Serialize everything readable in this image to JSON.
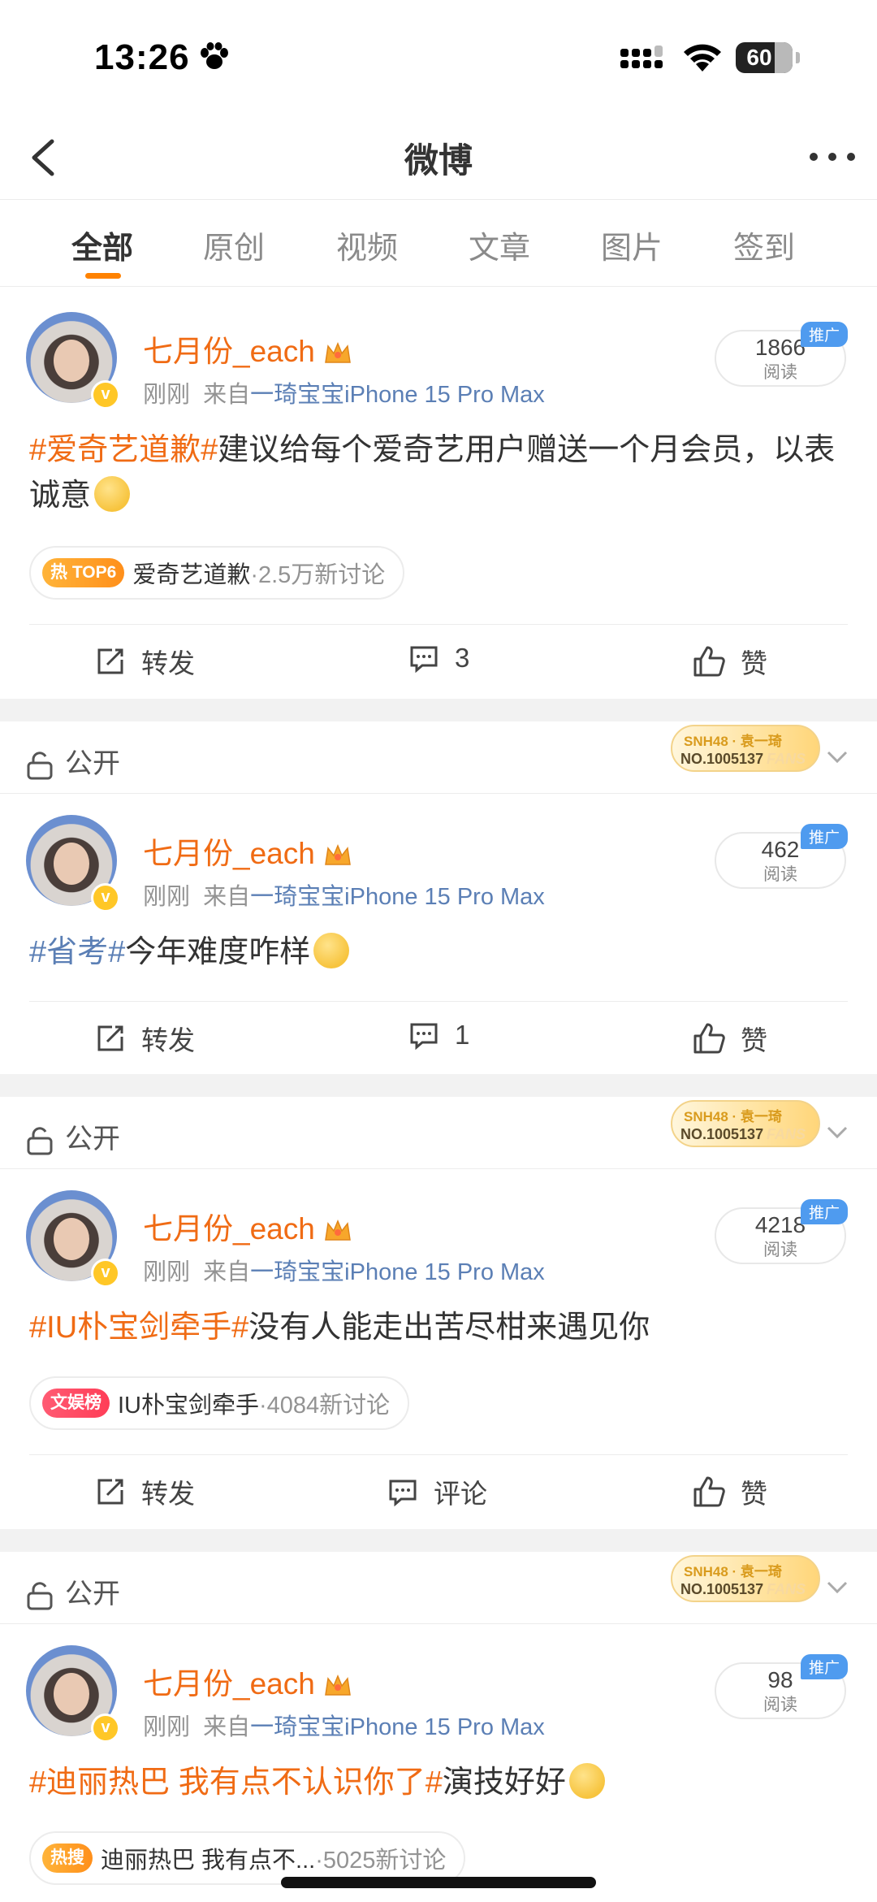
{
  "status_bar": {
    "time": "13:26",
    "battery": "60"
  },
  "nav": {
    "title": "微博"
  },
  "tabs": [
    "全部",
    "原创",
    "视频",
    "文章",
    "图片",
    "签到"
  ],
  "active_tab": "全部",
  "colors": {
    "accent": "#ff8200",
    "username": "#f06b14",
    "hashtag_orange": "#f06b14",
    "hashtag_blue": "#5b7fb5",
    "ad_badge": "#4f9bef"
  },
  "fans_badge": {
    "line1": "SNH48 · 袁一琦",
    "line2": "NO.1005137",
    "line3": "FANS"
  },
  "privacy_label": "公开",
  "posts": [
    {
      "username": "七月份_each",
      "time": "刚刚",
      "from_prefix": "来自",
      "source": "一琦宝宝iPhone 15 Pro Max",
      "reads": "1866",
      "reads_label": "阅读",
      "ad_label": "推广",
      "hashtag": "#爱奇艺道歉#",
      "body": "建议给每个爱奇艺用户赠送一个月会员，以表诚意",
      "topic": {
        "badge": "热 TOP6",
        "name": "爱奇艺道歉",
        "count": "·2.5万新讨论"
      },
      "actions": {
        "repost": "转发",
        "comment": "3",
        "like": "赞"
      }
    },
    {
      "username": "七月份_each",
      "time": "刚刚",
      "from_prefix": "来自",
      "source": "一琦宝宝iPhone 15 Pro Max",
      "reads": "462",
      "reads_label": "阅读",
      "ad_label": "推广",
      "hashtag": "#省考#",
      "body": "今年难度咋样",
      "actions": {
        "repost": "转发",
        "comment": "1",
        "like": "赞"
      }
    },
    {
      "username": "七月份_each",
      "time": "刚刚",
      "from_prefix": "来自",
      "source": "一琦宝宝iPhone 15 Pro Max",
      "reads": "4218",
      "reads_label": "阅读",
      "ad_label": "推广",
      "hashtag": "#IU朴宝剑牵手#",
      "body": "没有人能走出苦尽柑来遇见你",
      "topic": {
        "badge": "文娱榜",
        "name": "IU朴宝剑牵手",
        "count": "·4084新讨论"
      },
      "actions": {
        "repost": "转发",
        "comment": "评论",
        "like": "赞"
      }
    },
    {
      "username": "七月份_each",
      "time": "刚刚",
      "from_prefix": "来自",
      "source": "一琦宝宝iPhone 15 Pro Max",
      "reads": "98",
      "reads_label": "阅读",
      "ad_label": "推广",
      "hashtag": "#迪丽热巴 我有点不认识你了#",
      "body": "演技好好",
      "topic": {
        "badge": "热搜",
        "name": "迪丽热巴 我有点不...",
        "count": "·5025新讨论"
      }
    }
  ]
}
